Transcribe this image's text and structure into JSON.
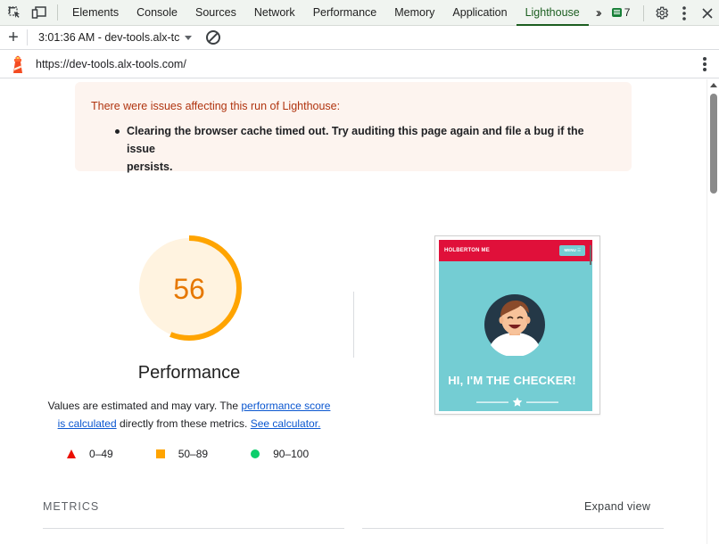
{
  "devtools": {
    "tabs": [
      {
        "label": "Elements"
      },
      {
        "label": "Console"
      },
      {
        "label": "Sources"
      },
      {
        "label": "Network"
      },
      {
        "label": "Performance"
      },
      {
        "label": "Memory"
      },
      {
        "label": "Application"
      },
      {
        "label": "Lighthouse"
      }
    ],
    "active_tab": "Lighthouse",
    "issues_count": "7",
    "icons": [
      "inspect-element-icon",
      "device-toolbar-icon",
      "more-tabs-icon",
      "issues-icon",
      "settings-icon",
      "more-options-icon",
      "close-icon"
    ]
  },
  "lighthouse_toolbar": {
    "report_label": "3:01:36 AM - dev-tools.alx-tc",
    "icons": [
      "new-report-icon",
      "dropdown-caret-icon",
      "clear-all-icon"
    ]
  },
  "urlbar": {
    "url": "https://dev-tools.alx-tools.com/",
    "icons": [
      "lighthouse-logo-icon",
      "more-menu-icon"
    ]
  },
  "warning": {
    "title": "There were issues affecting this run of Lighthouse:",
    "items": [
      {
        "line1": "Clearing the browser cache timed out. Try auditing this page again and file a bug if the issue",
        "line2": "persists."
      }
    ]
  },
  "score": {
    "value": "56",
    "fraction": 0.56,
    "label": "Performance",
    "color": "#ffa400",
    "background_color": "#fff3e0"
  },
  "description": {
    "text1": "Values are estimated and may vary. The",
    "link1a": "performance score",
    "link1b": "is calculated",
    "text2": "directly from these metrics.",
    "link2": "See calculator."
  },
  "legend": [
    {
      "range": "0–49",
      "color": "#eb0f00"
    },
    {
      "range": "50–89",
      "color": "#ffa400"
    },
    {
      "range": "90–100",
      "color": "#0cce6b"
    }
  ],
  "screenshot": {
    "brand": "HOLBERTON ME",
    "menu": "MENU ☰",
    "headline": "HI, I'M THE CHECKER!",
    "header_color": "#e0103a",
    "bg_color": "#74cdd3"
  },
  "metrics": {
    "heading": "METRICS",
    "expand_label": "Expand view"
  }
}
